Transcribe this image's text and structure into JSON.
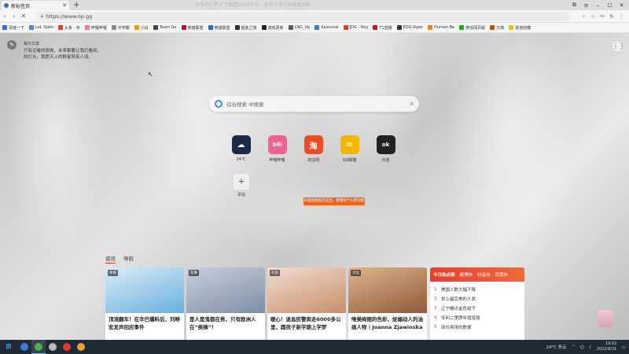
{
  "browser": {
    "tab_title": "新标签页",
    "top_notice": "本服务已累计下载超2000万次，支持中文在线搜索功能",
    "url": "https://www.op.gg",
    "bookmarks": [
      {
        "label": "百度一下",
        "color": "#2d6fd6"
      },
      {
        "label": "LoL Stats",
        "color": "#5383e8"
      },
      {
        "label": "头条 · 专",
        "color": "#e23b2e"
      },
      {
        "label": "哔哩哔哩",
        "color": "#fb7299"
      },
      {
        "label": "中学霸",
        "color": "#888888"
      },
      {
        "label": "小白",
        "color": "#f0a000"
      },
      {
        "label": "Team Ge",
        "color": "#444444"
      },
      {
        "label": "英雄联盟",
        "color": "#c8102e"
      },
      {
        "label": "英雄联盟",
        "color": "#1f6fd6"
      },
      {
        "label": "掘金之旅",
        "color": "#333333"
      },
      {
        "label": "游戏更新",
        "color": "#222222"
      },
      {
        "label": "LNG_Up",
        "color": "#5a5a5a"
      },
      {
        "label": "Kassunai",
        "color": "#3b7bd4"
      },
      {
        "label": "JDG · Hey",
        "color": "#e23b2e"
      },
      {
        "label": "T1直播",
        "color": "#c8102e"
      },
      {
        "label": "EDG-Viper",
        "color": "#333333"
      },
      {
        "label": "Human Be",
        "color": "#f08a00"
      },
      {
        "label": "微信网页版",
        "color": "#1aad19"
      },
      {
        "label": "文档",
        "color": "#d04a02"
      },
      {
        "label": "其他收藏",
        "color": "#f0c000"
      }
    ]
  },
  "page": {
    "quote_title": "每日文案",
    "quote_lines": [
      "只有迈着的夜晚，未来都要让我们看到，",
      "的灯光，我愿天上的群星照亮人间。"
    ],
    "search_placeholder": "综合搜索 中搜索",
    "shortcuts": [
      {
        "label": "24℃",
        "glyph": "☁",
        "color": "#1c2a4a"
      },
      {
        "label": "哔哩哔哩",
        "glyph": "bili",
        "color": "#f06292"
      },
      {
        "label": "淘宝网",
        "glyph": "淘",
        "color": "#ef4b24"
      },
      {
        "label": "QQ邮箱",
        "glyph": "✉",
        "color": "#f5b400"
      },
      {
        "label": "抖音",
        "glyph": "ok",
        "color": "#222222"
      }
    ],
    "add_label": "添加",
    "banner_text": "升级新版就在这里，看看有什么新功能",
    "news_tabs": [
      "资讯",
      "导航"
    ],
    "news": [
      {
        "tag": "体育",
        "title": "顶流翻车！在辛巴爆料后，刘畊宏发声回应事件",
        "colors": [
          "#6ab0de",
          "#d9ecf7"
        ]
      },
      {
        "tag": "军事",
        "title": "是人是鬼都在秀，只有欧洲人在“挨揍”！",
        "colors": [
          "#7d8ea3",
          "#c8d1dc"
        ]
      },
      {
        "tag": "社会",
        "title": "暖心！退昌民警奔走6000多公里，圆孩子新学期上学梦",
        "colors": [
          "#c98f6a",
          "#f0ddd0"
        ]
      },
      {
        "tag": "文化",
        "title": "唯美绚丽的色彩，妩媚动人的油画人物 | Joanna Zjawinska",
        "colors": [
          "#8f5a3a",
          "#e0b48c"
        ]
      }
    ],
    "hot_tabs": [
      "今日热点榜",
      "微博热",
      "抖音热",
      "百度热"
    ],
    "hot_list": [
      "美国人数大幅下降",
      "世上最完美的人类",
      "辽宁确诊金色蚊子",
      "专利二里牌年增增强",
      "原价商场的数据"
    ]
  },
  "taskbar": {
    "weather": "24℃ 多云",
    "time": "19:52",
    "date": "2022/8/31",
    "apps": [
      "#3a7bd5",
      "#4caf50",
      "#bbbbbb",
      "#e23b2e",
      "#f0a030"
    ]
  }
}
